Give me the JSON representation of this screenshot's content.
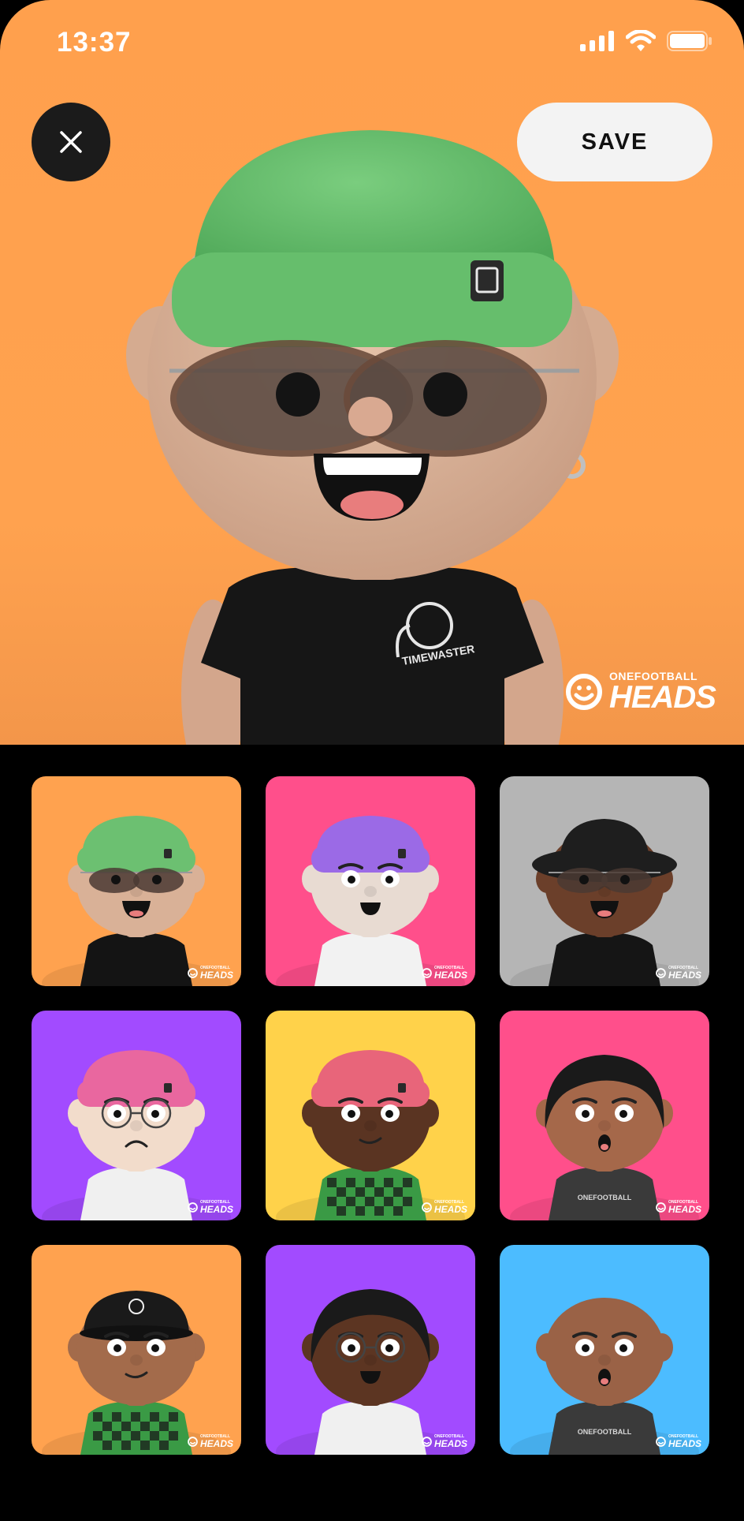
{
  "status_bar": {
    "time": "13:37"
  },
  "header": {
    "save_label": "SAVE"
  },
  "watermark": {
    "small": "ONEFOOTBALL",
    "big": "HEADS"
  },
  "hero_shirt_text": "TIMEWASTER",
  "tiles": [
    {
      "bg": "#FFA24F",
      "hat": "beanie",
      "hat_color": "#6CC071",
      "skin": "#D9B197",
      "glasses": "sun",
      "mouth": "smile",
      "shirt": "#141414",
      "shirt_text": ""
    },
    {
      "bg": "#FF4F8B",
      "hat": "beanie",
      "hat_color": "#9B6AE6",
      "skin": "#E8DBD2",
      "glasses": "none",
      "mouth": "open",
      "shirt": "#F2F2F2",
      "shirt_text": ""
    },
    {
      "bg": "#B5B5B5",
      "hat": "bucket",
      "hat_color": "#1E1E1E",
      "skin": "#6B3F2A",
      "glasses": "sun",
      "mouth": "smile",
      "shirt": "#151515",
      "shirt_text": ""
    },
    {
      "bg": "#A24BFF",
      "hat": "beanie",
      "hat_color": "#E9679F",
      "skin": "#F2DCCB",
      "glasses": "round",
      "mouth": "frown",
      "shirt": "#F0F0F0",
      "shirt_text": ""
    },
    {
      "bg": "#FFD24A",
      "hat": "beanie",
      "hat_color": "#E8657A",
      "skin": "#5A3422",
      "glasses": "none",
      "mouth": "smirk",
      "shirt": "#3A9A45",
      "shirt_text": ""
    },
    {
      "bg": "#FF4F8B",
      "hat": "hair",
      "hat_color": "#1A1A1A",
      "skin": "#A5684A",
      "glasses": "none",
      "mouth": "o",
      "shirt": "#3A3A3A",
      "shirt_text": "ONEFOOTBALL"
    },
    {
      "bg": "#FFA24F",
      "hat": "cap",
      "hat_color": "#1A1A1A",
      "skin": "#A36B4B",
      "glasses": "none",
      "mouth": "smirk",
      "shirt": "#3A9A45",
      "shirt_text": ""
    },
    {
      "bg": "#A24BFF",
      "hat": "hair",
      "hat_color": "#1A1A1A",
      "skin": "#5C3522",
      "glasses": "round",
      "mouth": "open",
      "shirt": "#F0F0F0",
      "shirt_text": ""
    },
    {
      "bg": "#4CBCFF",
      "hat": "bald",
      "hat_color": "#9A6246",
      "skin": "#9A6246",
      "glasses": "none",
      "mouth": "o",
      "shirt": "#3A3A3A",
      "shirt_text": "ONEFOOTBALL"
    }
  ]
}
